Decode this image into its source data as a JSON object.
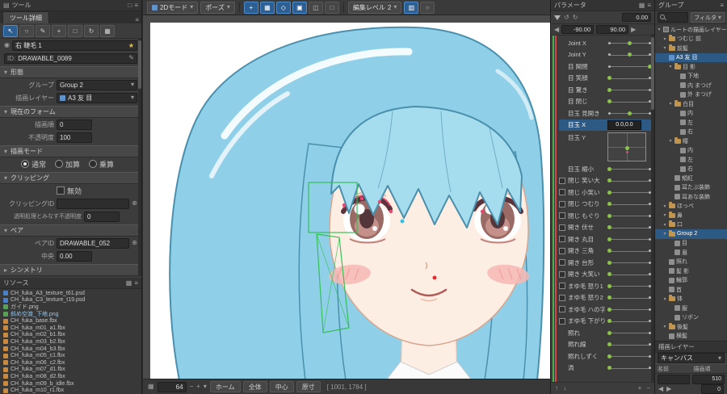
{
  "colors": {
    "accent": "#3d7cc9",
    "toggle_active": "#2e5f93",
    "selection_row": "#2d5a85",
    "hair": "#8fd0e8",
    "hair_light": "#a5dcee",
    "hair_line": "#4a90ad",
    "skin": "#fdeee4",
    "skin_line": "#d9a58e",
    "iris": "#9a6a64",
    "iris_dark": "#53363a",
    "blush": "#f7b9b4",
    "mouth": "#b05a56",
    "mesh_green": "#2fbf4f",
    "handle_pink": "#e8486f",
    "handle_cyan": "#37c4de",
    "handle_red": "#e03030",
    "param_green": "#8bc34a",
    "strip_green": "#4cae4c",
    "strip_red": "#d04848"
  },
  "icons": {
    "menu": "≡",
    "rows": "▤",
    "grid": "▦",
    "grid2": "▥",
    "square": "□",
    "box": "▣",
    "columns": "◫",
    "circle": "○",
    "diamond": "◇",
    "caret_down": "▾",
    "caret_right": "▸",
    "eye": "◉",
    "pencil": "✎",
    "target": "⊕",
    "plus": "+",
    "minus": "−",
    "up": "↑",
    "down": "↓",
    "left": "◀",
    "right": "▶",
    "undo": "↺",
    "redo": "↻",
    "cursor": "↖"
  },
  "toolbar": {
    "mode_label": "2Dモード",
    "pose_label": "ポーズ",
    "edit_level_label": "編集レベル",
    "edit_level_value": "2",
    "toggles_a": [
      {
        "name": "snap-toggle",
        "glyph": "+",
        "active": true
      },
      {
        "name": "grid-toggle",
        "glyph": "▦",
        "active": true
      },
      {
        "name": "mesh-toggle",
        "glyph": "◇",
        "active": true
      },
      {
        "name": "handle-toggle",
        "glyph": "▣",
        "active": true
      },
      {
        "name": "onion-skin-toggle",
        "glyph": "◫",
        "active": false
      },
      {
        "name": "lock-toggle",
        "glyph": "□",
        "active": false
      }
    ],
    "toggles_b": [
      {
        "name": "guide-toggle",
        "glyph": "▥",
        "active": true
      },
      {
        "name": "outline-toggle",
        "glyph": "○",
        "active": false
      }
    ]
  },
  "tools_panel": {
    "title": "ツール",
    "detail_tab": "ツール詳細",
    "tools": [
      {
        "name": "arrow-tool",
        "glyph": "↖",
        "active": true
      },
      {
        "name": "lasso-tool",
        "glyph": "○",
        "active": false
      },
      {
        "name": "brush-tool",
        "glyph": "✎",
        "active": false
      },
      {
        "name": "add-point-tool",
        "glyph": "+",
        "active": false
      },
      {
        "name": "rect-tool",
        "glyph": "□",
        "active": false
      },
      {
        "name": "rotate-tool",
        "glyph": "↻",
        "active": false
      },
      {
        "name": "grid-tool",
        "glyph": "▦",
        "active": false
      }
    ]
  },
  "inspector": {
    "name_value": "右 睫毛 1",
    "star": "★",
    "id_label": "ID:",
    "id_value": "DRAWABLE_0089",
    "sec_form": "形態",
    "group_label": "グループ",
    "group_value": "Group 2",
    "layer_label": "描画レイヤー",
    "layer_value": "A3 友 目",
    "sec_current_form": "現在のフォーム",
    "draw_order_label": "描画順",
    "draw_order_value": "0",
    "opacity_label": "不透明度",
    "opacity_value": "100",
    "sec_blend": "描画モード",
    "blend_options": [
      "通常",
      "加算",
      "乗算"
    ],
    "blend_selected": 0,
    "sec_clipping": "クリッピング",
    "clip_invalid_label": "無効",
    "clip_id_label": "クリッピングID",
    "clip_id_value": "",
    "clip_alpha_label": "透明処理とみなす不透明度",
    "clip_alpha_value": "0",
    "sec_pair": "ペア",
    "pair_id_label": "ペアID",
    "pair_id_value": "DRAWABLE_052",
    "pair_center_label": "中央",
    "pair_center_value": "0.00",
    "sec_symmetry": "シンメトリ"
  },
  "resources": {
    "title": "リソース",
    "files": [
      {
        "name": "CH_fuka_A3_texture_t61.psd",
        "type": "psd",
        "selected": false
      },
      {
        "name": "CH_fuka_C3_texture_t19.psd",
        "type": "psd",
        "selected": false
      },
      {
        "name": "ガイド.png",
        "type": "png",
        "selected": false
      },
      {
        "name": "斜め空渡_下地.png",
        "type": "png",
        "selected": true
      },
      {
        "name": "CH_fuka_base.fbx",
        "type": "fbx",
        "selected": false
      },
      {
        "name": "CH_fuka_m01_a1.fbx",
        "type": "fbx",
        "selected": false
      },
      {
        "name": "CH_fuka_m02_b1.fbx",
        "type": "fbx",
        "selected": false
      },
      {
        "name": "CH_fuka_m03_b2.fbx",
        "type": "fbx",
        "selected": false
      },
      {
        "name": "CH_fuka_m04_b3.fbx",
        "type": "fbx",
        "selected": false
      },
      {
        "name": "CH_fuka_m05_c1.fbx",
        "type": "fbx",
        "selected": false
      },
      {
        "name": "CH_fuka_m06_c2.fbx",
        "type": "fbx",
        "selected": false
      },
      {
        "name": "CH_fuka_m07_d1.fbx",
        "type": "fbx",
        "selected": false
      },
      {
        "name": "CH_fuka_m08_d2.fbx",
        "type": "fbx",
        "selected": false
      },
      {
        "name": "CH_fuka_m09_b_idle.fbx",
        "type": "fbx",
        "selected": false
      },
      {
        "name": "CH_fuka_m10_r1.fbx",
        "type": "fbx",
        "selected": false
      }
    ]
  },
  "canvas": {
    "statusbar": {
      "zoom": "64",
      "buttons": [
        "ホーム",
        "全体",
        "中心",
        "原寸"
      ],
      "coords": "[ 1001, 1784 ]"
    }
  },
  "parameters": {
    "title": "パラメータ",
    "value_field": "0.00",
    "min_field": "-90.00",
    "max_field": "90.00",
    "items": [
      {
        "name": "Joint X",
        "dots": [
          0,
          0.5,
          1
        ],
        "cur": 0.5
      },
      {
        "name": "Joint Y",
        "dots": [
          0,
          0.5,
          1
        ],
        "cur": 0.5
      },
      {
        "name": "目 開閉",
        "dots": [
          0,
          1
        ],
        "cur": 1
      },
      {
        "name": "目 笑顔",
        "dots": [
          0,
          1
        ],
        "cur": 0
      },
      {
        "name": "目 驚き",
        "dots": [
          0,
          1
        ],
        "cur": 0
      },
      {
        "name": "目 閉じ",
        "dots": [
          0,
          1
        ],
        "cur": 0
      },
      {
        "name": "目玉 見開き",
        "dots": [
          0,
          0.5,
          1
        ],
        "cur": 0.5
      },
      {
        "name": "目玉 X",
        "selected": true,
        "value": "0.0,0.0",
        "pad": true,
        "pad_label": "目玉 Y"
      },
      {
        "name": "目玉 縮小",
        "dots": [
          0,
          1
        ],
        "cur": 0
      },
      {
        "name": "閉じ 笑い大",
        "check": true,
        "dots": [
          0,
          1
        ],
        "cur": 0
      },
      {
        "name": "閉じ 小笑い",
        "check": true,
        "dots": [
          0,
          1
        ],
        "cur": 0
      },
      {
        "name": "閉じ つむり",
        "check": true,
        "dots": [
          0,
          1
        ],
        "cur": 0
      },
      {
        "name": "閉じ もぐり",
        "check": true,
        "dots": [
          0,
          1
        ],
        "cur": 0
      },
      {
        "name": "開き 伏せ",
        "check": true,
        "dots": [
          0,
          1
        ],
        "cur": 0
      },
      {
        "name": "開き 丸目",
        "check": true,
        "dots": [
          0,
          1
        ],
        "cur": 0
      },
      {
        "name": "開き 三角",
        "check": true,
        "dots": [
          0,
          1
        ],
        "cur": 0
      },
      {
        "name": "開き 台形",
        "check": true,
        "dots": [
          0,
          1
        ],
        "cur": 0
      },
      {
        "name": "開き 大笑い",
        "check": true,
        "dots": [
          0,
          1
        ],
        "cur": 0
      },
      {
        "name": "まゆ毛 怒り1",
        "check": true,
        "dots": [
          0,
          1
        ],
        "cur": 0
      },
      {
        "name": "まゆ毛 怒り2",
        "check": true,
        "dots": [
          0,
          1
        ],
        "cur": 0
      },
      {
        "name": "まゆ毛 ハの字",
        "check": true,
        "dots": [
          0,
          1
        ],
        "cur": 0
      },
      {
        "name": "まゆ毛 下がり",
        "check": true,
        "dots": [
          0,
          1
        ],
        "cur": 0
      },
      {
        "name": "照れ",
        "dots": [
          0,
          1
        ],
        "cur": 0
      },
      {
        "name": "照れ線",
        "dots": [
          0,
          1
        ],
        "cur": 0
      },
      {
        "name": "照れしずく",
        "dots": [
          0,
          1
        ],
        "cur": 0
      },
      {
        "name": "渦",
        "dots": [
          0,
          1
        ],
        "cur": 0
      }
    ]
  },
  "groups": {
    "title": "グループ",
    "filter_label": "フィルタ",
    "tree": [
      {
        "label": "ルートの描画レイヤーを検証",
        "depth": 0,
        "type": "root",
        "selected": false
      },
      {
        "label": "つむじ 前",
        "depth": 1,
        "type": "folder",
        "selected": false
      },
      {
        "label": "前髪",
        "depth": 1,
        "type": "folder",
        "selected": false
      },
      {
        "label": "A3 友 目",
        "depth": 1,
        "type": "layer",
        "selected": true
      },
      {
        "label": "目 影",
        "depth": 2,
        "type": "folder",
        "selected": false
      },
      {
        "label": "下地",
        "depth": 3,
        "type": "part",
        "selected": false
      },
      {
        "label": "内 まつげ",
        "depth": 3,
        "type": "part",
        "selected": false
      },
      {
        "label": "外 まつげ",
        "depth": 3,
        "type": "part",
        "selected": false
      },
      {
        "label": "白目",
        "depth": 2,
        "type": "folder",
        "selected": false
      },
      {
        "label": "内",
        "depth": 3,
        "type": "part",
        "selected": false
      },
      {
        "label": "左",
        "depth": 3,
        "type": "part",
        "selected": false
      },
      {
        "label": "右",
        "depth": 3,
        "type": "part",
        "selected": false
      },
      {
        "label": "瞳",
        "depth": 2,
        "type": "folder",
        "selected": false
      },
      {
        "label": "内",
        "depth": 3,
        "type": "part",
        "selected": false
      },
      {
        "label": "左",
        "depth": 3,
        "type": "part",
        "selected": false
      },
      {
        "label": "右",
        "depth": 3,
        "type": "part",
        "selected": false
      },
      {
        "label": "頬紅",
        "depth": 2,
        "type": "part",
        "selected": false
      },
      {
        "label": "耳たぶ装飾",
        "depth": 2,
        "type": "part",
        "selected": false
      },
      {
        "label": "耳あな装飾",
        "depth": 2,
        "type": "part",
        "selected": false
      },
      {
        "label": "ほっぺ",
        "depth": 1,
        "type": "folder",
        "selected": false
      },
      {
        "label": "鼻",
        "depth": 1,
        "type": "folder",
        "selected": false
      },
      {
        "label": "口",
        "depth": 1,
        "type": "folder",
        "selected": false
      },
      {
        "label": "Group 2",
        "depth": 1,
        "type": "folder",
        "selected": true
      },
      {
        "label": "目",
        "depth": 2,
        "type": "part",
        "selected": false
      },
      {
        "label": "眉",
        "depth": 2,
        "type": "part",
        "selected": false
      },
      {
        "label": "照れ",
        "depth": 1,
        "type": "part",
        "selected": false
      },
      {
        "label": "髪 影",
        "depth": 1,
        "type": "part",
        "selected": false
      },
      {
        "label": "輪郭",
        "depth": 1,
        "type": "part",
        "selected": false
      },
      {
        "label": "首",
        "depth": 1,
        "type": "part",
        "selected": false
      },
      {
        "label": "体",
        "depth": 1,
        "type": "folder",
        "selected": false
      },
      {
        "label": "服",
        "depth": 2,
        "type": "part",
        "selected": false
      },
      {
        "label": "リボン",
        "depth": 2,
        "type": "part",
        "selected": false
      },
      {
        "label": "後髪",
        "depth": 1,
        "type": "folder",
        "selected": false
      },
      {
        "label": "横髪",
        "depth": 1,
        "type": "part",
        "selected": false
      }
    ],
    "layer_panel": {
      "title": "描画レイヤー",
      "canvas_value": "キャンバス",
      "name_header": "名前",
      "order_header": "描画順",
      "order_value": "510",
      "footer_value": "0"
    }
  }
}
